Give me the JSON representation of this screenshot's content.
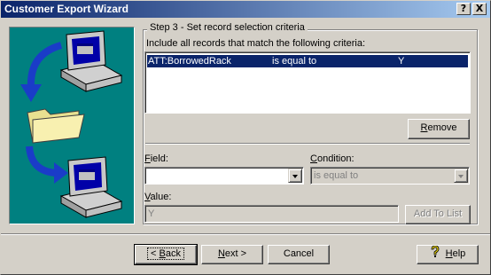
{
  "window": {
    "title": "Customer Export Wizard",
    "help_glyph": "?",
    "close_glyph": "X"
  },
  "step": {
    "title": "Step 3 - Set record selection criteria",
    "instruction": "Include all records that match the following criteria:"
  },
  "criteria_list": {
    "rows": [
      {
        "field": "ATT:BorrowedRack",
        "condition": "is equal to",
        "value": "Y",
        "selected": true
      }
    ]
  },
  "buttons": {
    "remove": {
      "pre": "",
      "accel": "R",
      "post": "emove"
    },
    "add_to_list": "Add To List",
    "back": {
      "pre": "< ",
      "accel": "B",
      "post": "ack"
    },
    "next": {
      "pre": "",
      "accel": "N",
      "post": "ext >"
    },
    "cancel": "Cancel",
    "help": {
      "pre": "",
      "accel": "H",
      "post": "elp"
    }
  },
  "form": {
    "field_label": {
      "pre": "",
      "accel": "F",
      "post": "ield:"
    },
    "field_value": "",
    "condition_label": {
      "pre": "",
      "accel": "C",
      "post": "ondition:"
    },
    "condition_value": "is equal to",
    "value_label": {
      "pre": "",
      "accel": "V",
      "post": "alue:"
    },
    "value_value": "Y"
  },
  "icons": {
    "art": [
      "computer-icon",
      "folder-icon",
      "arrow-icon"
    ],
    "help": "help-question-icon"
  },
  "colors": {
    "titlebar_start": "#0a246a",
    "titlebar_end": "#a6caf0",
    "art_background": "#008080",
    "selection": "#0a246a",
    "face": "#d4d0c8"
  }
}
